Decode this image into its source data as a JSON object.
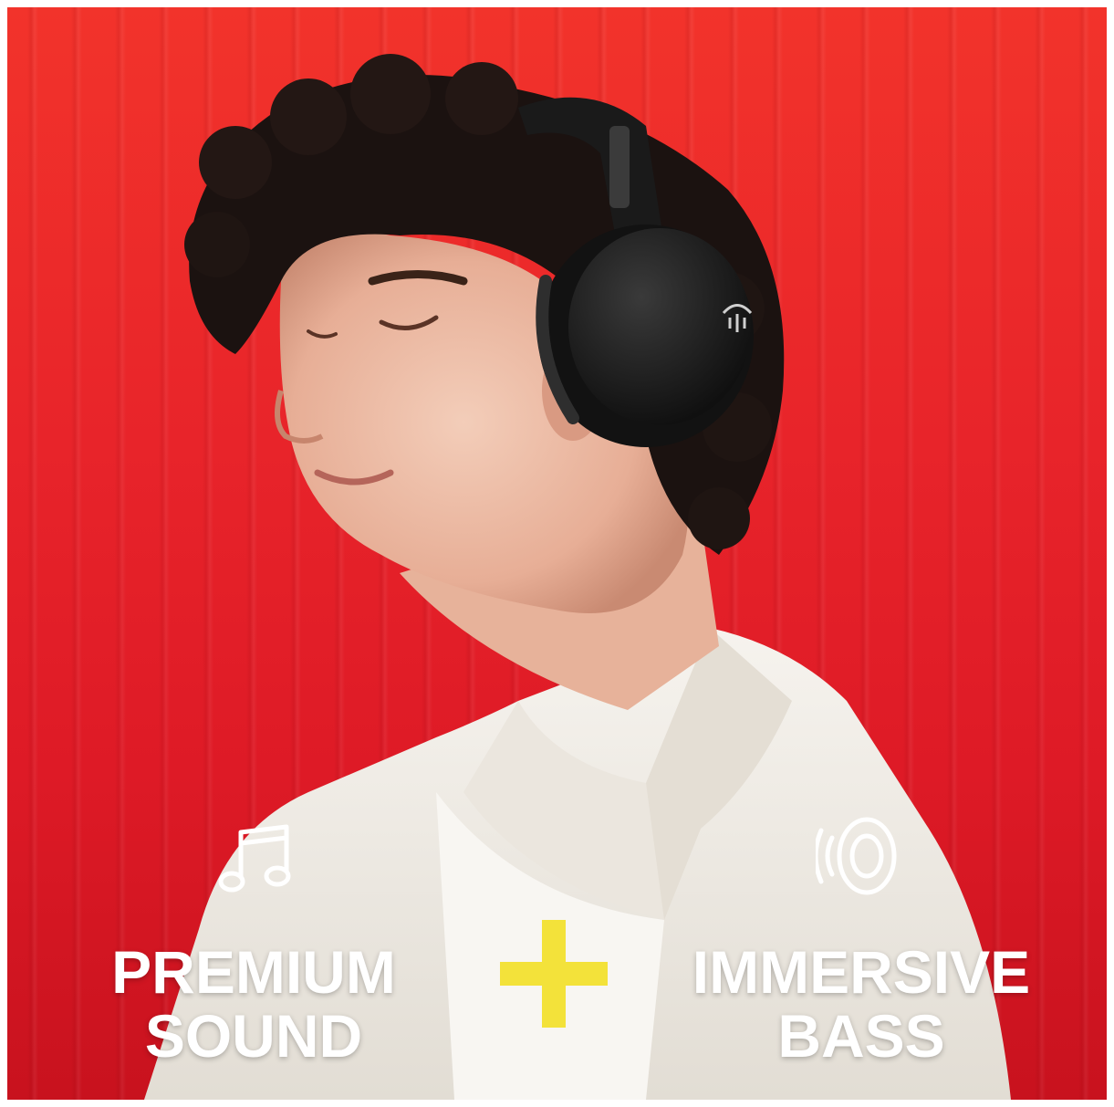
{
  "features": {
    "left": {
      "line1": "PREMIUM",
      "line2": "SOUND",
      "icon": "music-note-icon"
    },
    "right": {
      "line1": "IMMERSIVE",
      "line2": "BASS",
      "icon": "speaker-sound-icon"
    },
    "separator_icon": "plus-icon"
  },
  "colors": {
    "background": "#e8242a",
    "text": "#ffffff",
    "plus": "#f3e23a",
    "headphones": "#1a1a1a",
    "shirt": "#f2efe9"
  }
}
